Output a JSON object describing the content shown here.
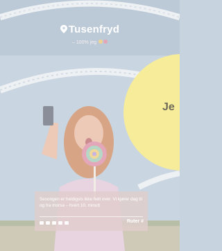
{
  "brand": {
    "name": "Tusenfryd",
    "pin_icon": "location-pin-icon"
  },
  "tagline": {
    "text": "– 100% jeg"
  },
  "bubble": {
    "text": "Je",
    "color": "#f6ec9a"
  },
  "card": {
    "text": "Sesongen er heldigvis ikke helt over. Vi kjører dag til og fra morsa – hvert 10. minutt",
    "cta": "Ruter",
    "cta_icon": "hash-icon",
    "social_icons": [
      "facebook-icon",
      "twitter-icon",
      "mail-icon",
      "share-icon",
      "more-icon"
    ]
  },
  "colors": {
    "sky": "#c7d3df",
    "card_bg": "#e0cdcc",
    "bubble": "#f6ec9a",
    "hair": "#d7a585",
    "jacket": "#e8d4e1"
  }
}
